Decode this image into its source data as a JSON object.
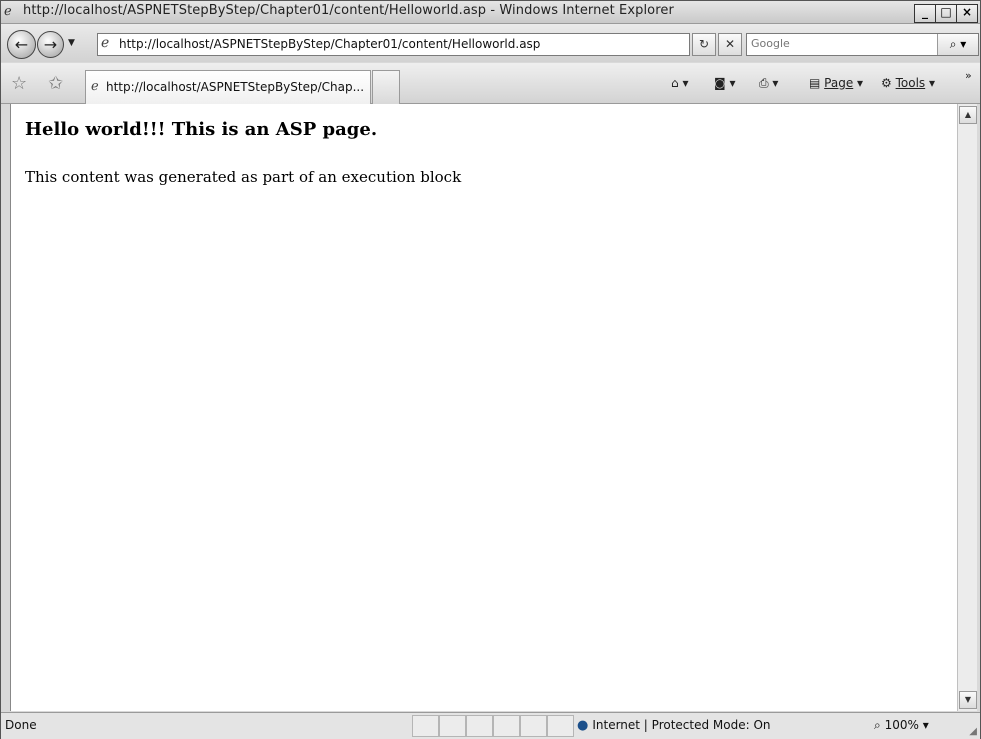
{
  "window": {
    "title": "http://localhost/ASPNETStepByStep/Chapter01/content/Helloworld.asp - Windows Internet Explorer",
    "minimize_glyph": "_",
    "maximize_glyph": "□",
    "close_glyph": "×"
  },
  "navigation": {
    "address_url": "http://localhost/ASPNETStepByStep/Chapter01/content/Helloworld.asp",
    "search_placeholder": "Google"
  },
  "command_bar": {
    "tab_title": "http://localhost/ASPNETStepByStep/Chap...",
    "page_label": "Page",
    "tools_label": "Tools",
    "more_glyph": "»"
  },
  "page": {
    "heading": "Hello world!!! This is an ASP page.",
    "paragraph": "This content was generated as part of an execution block"
  },
  "status": {
    "text": "Done",
    "zone": "Internet | Protected Mode: On",
    "zoom": "100%"
  },
  "icons": [
    "ie-logo-icon",
    "back-icon",
    "forward-icon",
    "page-icon",
    "refresh-icon",
    "stop-icon",
    "search-icon",
    "favorites-star-icon",
    "add-favorites-icon",
    "home-icon",
    "feeds-icon",
    "print-icon",
    "page-menu-icon",
    "tools-gear-icon",
    "globe-icon",
    "zoom-icon",
    "resize-grip-icon"
  ]
}
